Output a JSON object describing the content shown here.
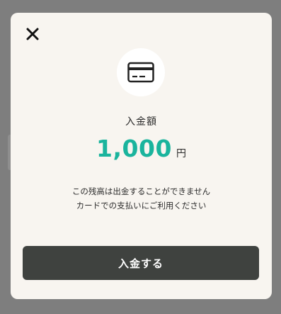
{
  "modal": {
    "label": "入金額",
    "amount": "1,000",
    "unit": "円",
    "note_line1": "この残高は出金することができません",
    "note_line2": "カードでの支払いにご利用ください",
    "cta_label": "入金する",
    "accent_color": "#1ab49d"
  },
  "icons": {
    "close": "close-icon",
    "card": "credit-card-icon"
  }
}
